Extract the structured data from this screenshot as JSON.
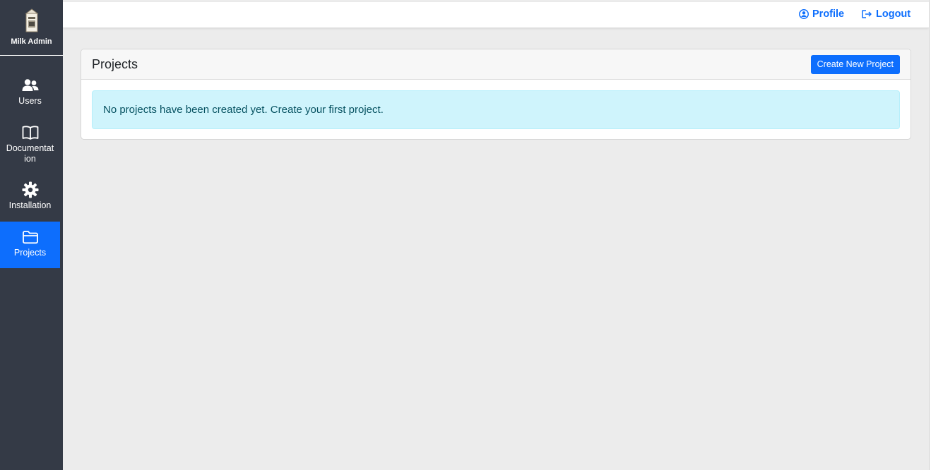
{
  "brand": {
    "name": "Milk Admin"
  },
  "sidebar": {
    "items": [
      {
        "label": "Users",
        "icon": "users-icon",
        "active": false
      },
      {
        "label": "Documentat ion",
        "icon": "book-icon",
        "active": false
      },
      {
        "label": "Installation",
        "icon": "gear-icon",
        "active": false
      },
      {
        "label": "Projects",
        "icon": "folder-icon",
        "active": true
      }
    ]
  },
  "topbar": {
    "profile_label": "Profile",
    "logout_label": "Logout"
  },
  "main": {
    "card_title": "Projects",
    "create_button_label": "Create New Project",
    "empty_message": "No projects have been created yet. Create your first project."
  },
  "colors": {
    "sidebar_bg": "#343a46",
    "accent": "#0d6efd",
    "alert_bg": "#cff4fc",
    "page_bg": "#ececec"
  }
}
